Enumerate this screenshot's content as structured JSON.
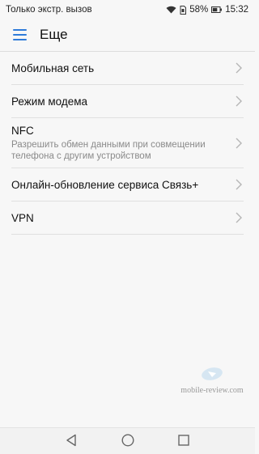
{
  "status_bar": {
    "carrier": "Только экстр. вызов",
    "battery": "58%",
    "time": "15:32"
  },
  "app_bar": {
    "title": "Еще"
  },
  "items": [
    {
      "label": "Мобильная сеть"
    },
    {
      "label": "Режим модема"
    },
    {
      "label": "NFC",
      "sub": "Разрешить обмен данными при совмещении телефона с другим устройством"
    },
    {
      "label": "Онлайн-обновление сервиса Связь+"
    },
    {
      "label": "VPN"
    }
  ],
  "watermark": {
    "text": "mobile-review.com"
  },
  "nav_bar": {
    "icons": [
      "back-icon",
      "home-icon",
      "recents-icon"
    ]
  },
  "colors": {
    "accent": "#2f7bd9",
    "background": "#f7f7f7",
    "divider": "#e0e0e0",
    "secondary_text": "#8a8a8a"
  }
}
